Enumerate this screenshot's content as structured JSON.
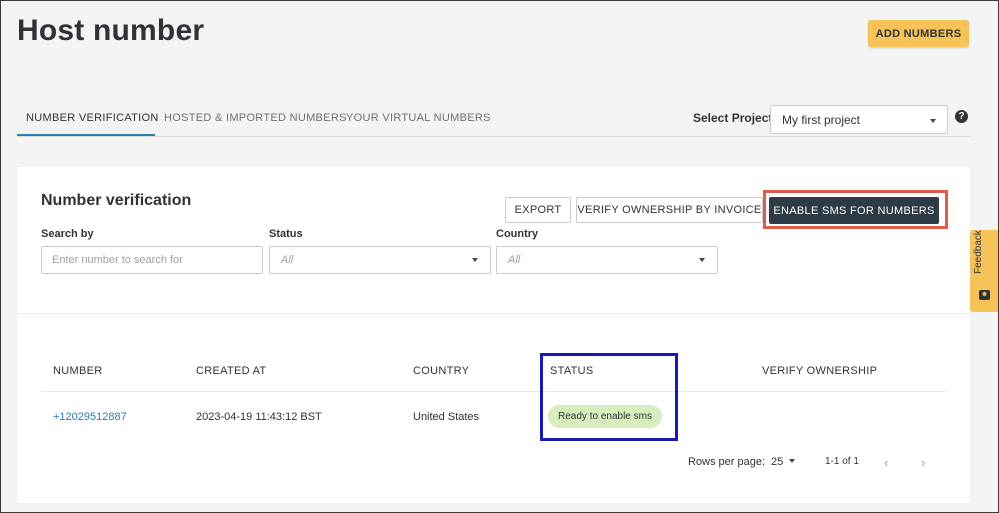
{
  "header": {
    "title": "Host number",
    "add_button": "ADD NUMBERS"
  },
  "tabs": [
    {
      "label": "NUMBER VERIFICATION",
      "active": true
    },
    {
      "label": "HOSTED & IMPORTED NUMBERS",
      "active": false
    },
    {
      "label": "YOUR VIRTUAL NUMBERS",
      "active": false
    }
  ],
  "project": {
    "label": "Select Project",
    "value": "My first project",
    "help": "?"
  },
  "card": {
    "title": "Number verification",
    "export_button": "EXPORT",
    "verify_invoice_button": "VERIFY OWNERSHIP BY INVOICE",
    "enable_sms_button": "ENABLE SMS FOR NUMBERS",
    "filters": {
      "search_label": "Search by",
      "search_placeholder": "Enter number to search for",
      "status_label": "Status",
      "status_value": "All",
      "country_label": "Country",
      "country_value": "All"
    },
    "table": {
      "headers": [
        "NUMBER",
        "CREATED AT",
        "COUNTRY",
        "STATUS",
        "VERIFY OWNERSHIP"
      ],
      "rows": [
        {
          "number": "+12029512887",
          "created_at": "2023-04-19 11:43:12 BST",
          "country": "United States",
          "status": "Ready to enable sms",
          "verify_ownership": ""
        }
      ]
    },
    "pagination": {
      "rows_label": "Rows per page:",
      "rows_value": "25",
      "range": "1-1 of 1"
    }
  },
  "feedback": {
    "label": "Feedback"
  },
  "colors": {
    "accent_yellow": "#f6c358",
    "dark_button": "#2e3a45",
    "link_blue": "#2b7fad",
    "status_green": "#d7edbe",
    "highlight_red": "#dd5c4c",
    "highlight_blue": "#1a1ab0"
  }
}
